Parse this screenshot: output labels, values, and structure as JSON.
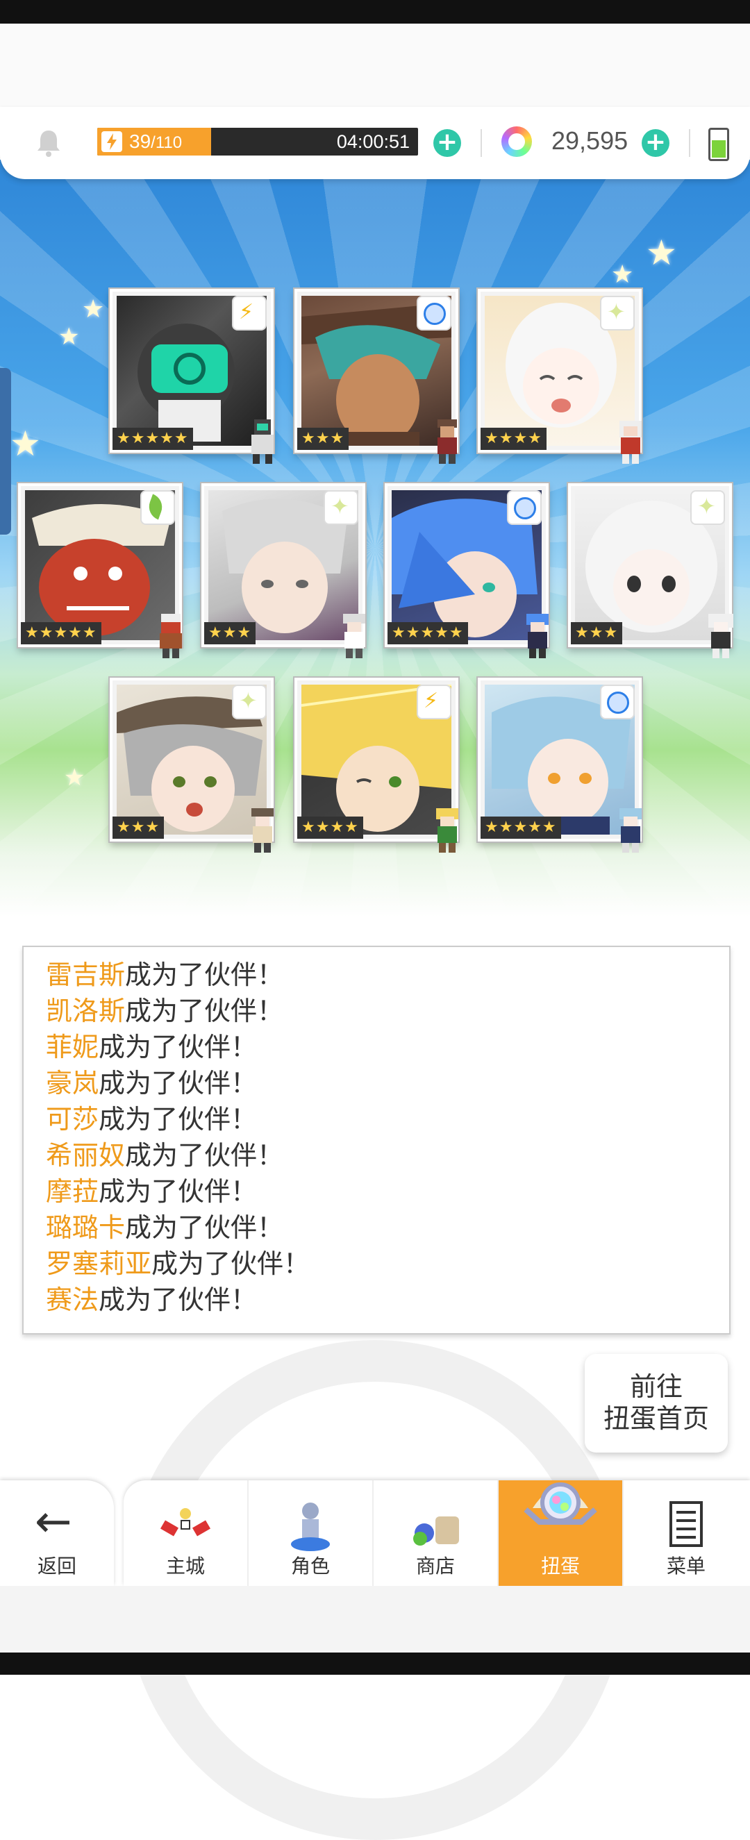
{
  "status": {
    "stamina_current": "39",
    "stamina_max": "/110",
    "stamina_fraction": 0.355,
    "timer": "04:00:51",
    "gems": "29,595",
    "battery_fraction": 0.6
  },
  "cards": [
    {
      "name": "雷吉斯",
      "stars": "★★★★★",
      "element": "bolt-icon"
    },
    {
      "name": "凯洛斯",
      "stars": "★★★",
      "element": "water-icon"
    },
    {
      "name": "菲妮",
      "stars": "★★★★",
      "element": "light-icon"
    },
    {
      "name": "豪岚",
      "stars": "★★★★★",
      "element": "earth-icon"
    },
    {
      "name": "可莎",
      "stars": "★★★",
      "element": "light-icon"
    },
    {
      "name": "希丽奴",
      "stars": "★★★★★",
      "element": "water-icon"
    },
    {
      "name": "摩菈",
      "stars": "★★★",
      "element": "light-icon"
    },
    {
      "name": "璐璐卡",
      "stars": "★★★",
      "element": "light-icon"
    },
    {
      "name": "罗塞莉亚",
      "stars": "★★★★",
      "element": "bolt-icon"
    },
    {
      "name": "赛法",
      "stars": "★★★★★",
      "element": "water-icon"
    }
  ],
  "messages": [
    {
      "name": "雷吉斯",
      "suffix": "成为了伙伴！"
    },
    {
      "name": "凯洛斯",
      "suffix": "成为了伙伴！"
    },
    {
      "name": "菲妮",
      "suffix": "成为了伙伴！"
    },
    {
      "name": "豪岚",
      "suffix": "成为了伙伴！"
    },
    {
      "name": "可莎",
      "suffix": "成为了伙伴！"
    },
    {
      "name": "希丽奴",
      "suffix": "成为了伙伴！"
    },
    {
      "name": "摩菈",
      "suffix": "成为了伙伴！"
    },
    {
      "name": "璐璐卡",
      "suffix": "成为了伙伴！"
    },
    {
      "name": "罗塞莉亚",
      "suffix": "成为了伙伴！"
    },
    {
      "name": "赛法",
      "suffix": "成为了伙伴！"
    }
  ],
  "goto_button": {
    "line1": "前往",
    "line2": "扭蛋首页"
  },
  "nav": {
    "back": "返回",
    "tabs": [
      {
        "label": "主城",
        "icon": "castle-icon"
      },
      {
        "label": "角色",
        "icon": "character-icon"
      },
      {
        "label": "商店",
        "icon": "shop-icon"
      },
      {
        "label": "扭蛋",
        "icon": "gacha-icon"
      },
      {
        "label": "菜单",
        "icon": "menu-icon"
      }
    ]
  },
  "colors": {
    "accent": "#f7a12c",
    "teal": "#2fc7a8",
    "name_highlight": "#ef9a1a"
  }
}
